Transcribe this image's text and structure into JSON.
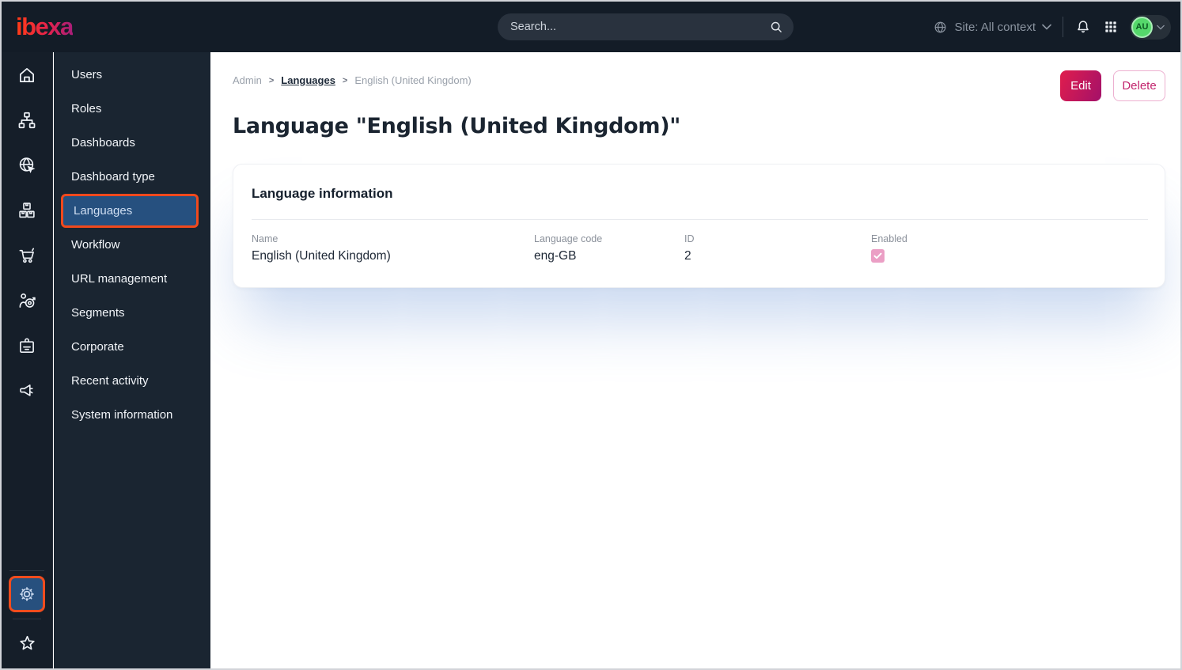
{
  "topbar": {
    "logo": "ibexa",
    "search_placeholder": "Search...",
    "site_context": "Site: All context",
    "avatar_initials": "AU"
  },
  "icon_rail": {
    "items": [
      "home",
      "content-structure",
      "site",
      "product-catalog",
      "commerce",
      "personalization",
      "corporate",
      "campaign"
    ],
    "bottom_items": [
      "admin-settings",
      "bookmarks"
    ],
    "active_item": "admin-settings"
  },
  "sidebar": {
    "items": [
      {
        "label": "Users",
        "active": false
      },
      {
        "label": "Roles",
        "active": false
      },
      {
        "label": "Dashboards",
        "active": false
      },
      {
        "label": "Dashboard type",
        "active": false
      },
      {
        "label": "Languages",
        "active": true
      },
      {
        "label": "Workflow",
        "active": false
      },
      {
        "label": "URL management",
        "active": false
      },
      {
        "label": "Segments",
        "active": false
      },
      {
        "label": "Corporate",
        "active": false
      },
      {
        "label": "Recent activity",
        "active": false
      },
      {
        "label": "System information",
        "active": false
      }
    ]
  },
  "breadcrumb": {
    "separator": ">",
    "items": [
      "Admin",
      "Languages",
      "English (United Kingdom)"
    ]
  },
  "actions": {
    "edit_label": "Edit",
    "delete_label": "Delete"
  },
  "page": {
    "title": "Language \"English (United Kingdom)\""
  },
  "card": {
    "title": "Language information",
    "fields": [
      {
        "label": "Name",
        "value": "English (United Kingdom)"
      },
      {
        "label": "Language code",
        "value": "eng-GB"
      },
      {
        "label": "ID",
        "value": "2"
      },
      {
        "label": "Enabled",
        "value": "checked"
      }
    ]
  },
  "colors": {
    "topbar_bg": "#131c27",
    "sidebar_bg": "#1a2531",
    "rail_bg": "#151e29",
    "highlight_blue": "#26507f",
    "annotation_orange": "#f0491d",
    "brand_gradient_start": "#ff3c16",
    "brand_gradient_end": "#a81e79",
    "edit_btn_gradient": [
      "#e01d4d",
      "#a31169"
    ],
    "delete_btn_text": "#c2266e",
    "checkbox_pink": "#eb9fc5",
    "avatar_green": "#55d86b",
    "card_shadow": "rgba(86,134,208,0.32)"
  }
}
